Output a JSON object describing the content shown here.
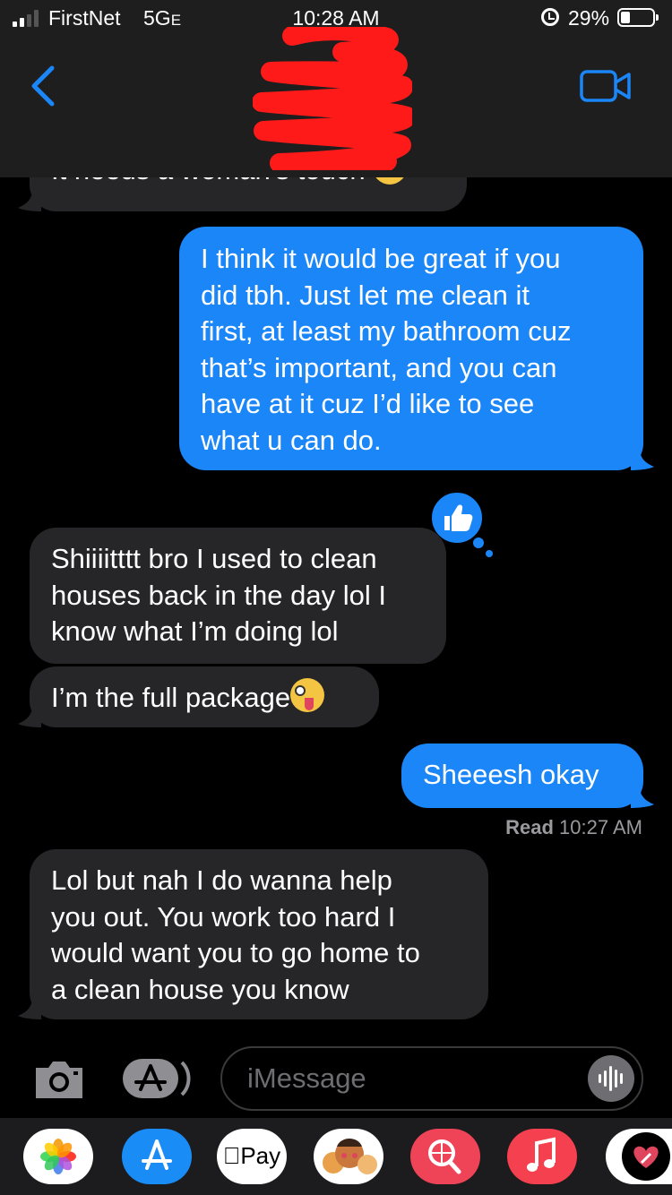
{
  "status_bar": {
    "carrier": "FirstNet",
    "network": "5G",
    "network_suffix": "E",
    "time": "10:28 AM",
    "battery_percent": "29%",
    "battery_level": 0.29
  },
  "header": {
    "contact_name_redacted": true
  },
  "messages": [
    {
      "direction": "incoming",
      "text": "It needs a woman's touch",
      "emoji": "laughing-face",
      "partially_hidden": true
    },
    {
      "direction": "outgoing",
      "lines": [
        "I think it would be great if you",
        "did tbh. Just let me clean it",
        "first, at least my bathroom cuz",
        "that’s important, and you can",
        "have at it cuz I’d like to see",
        "what u can do."
      ],
      "tapback": "thumbs-up"
    },
    {
      "direction": "incoming",
      "lines": [
        "Shiiiitttt bro I used to clean",
        "houses back in the day lol I",
        "know what I’m doing lol"
      ]
    },
    {
      "direction": "incoming",
      "text": "I’m the full package",
      "emoji": "zany-face"
    },
    {
      "direction": "outgoing",
      "text": "Sheeesh okay"
    },
    {
      "direction": "incoming",
      "lines": [
        "Lol but nah I do wanna help",
        "you out. You work too hard I",
        "would want you to go home to",
        "a clean house you know"
      ]
    }
  ],
  "read_receipt": {
    "label": "Read",
    "time": "10:27 AM"
  },
  "input_bar": {
    "placeholder": "iMessage"
  },
  "app_drawer": {
    "apps": [
      "photos-icon",
      "app-store-icon",
      "apple-pay-icon",
      "memoji-icon",
      "images-search-icon",
      "music-icon",
      "digital-touch-icon"
    ],
    "pay_label": "Pay"
  },
  "colors": {
    "accent": "#1b86f7",
    "incoming_bubble": "#262628",
    "header_bg": "#1e1e1e",
    "redaction": "#ff1a1a"
  }
}
